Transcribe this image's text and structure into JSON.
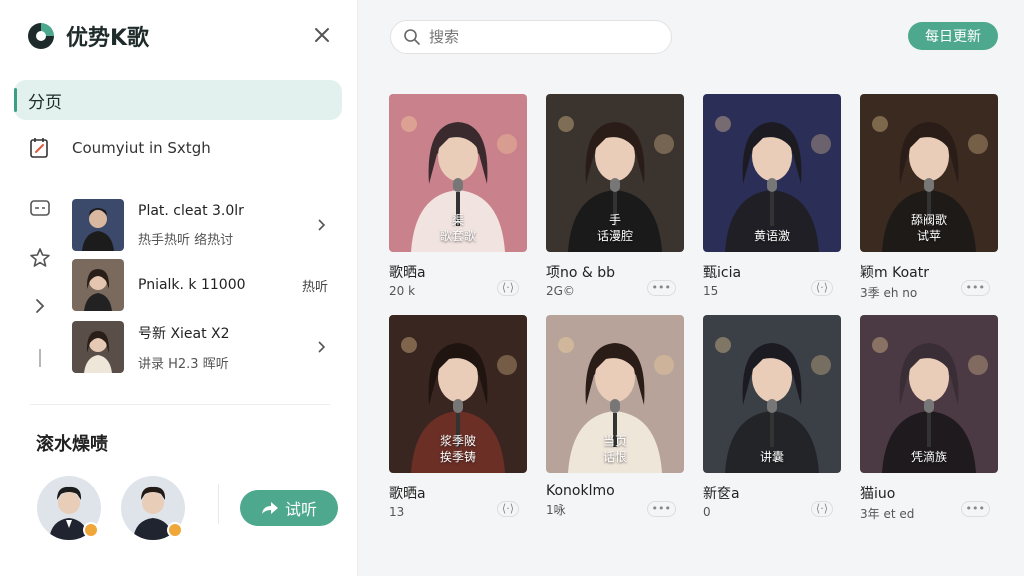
{
  "app": {
    "name": "优势K歌",
    "accent": "#4da88e"
  },
  "nav": {
    "active_label": "分页",
    "item_label": "Coumyiut in Sxtgh"
  },
  "recommendations": [
    {
      "title": "Plat. cleat 3.0lr",
      "subtitle": "热手热听 络热讨",
      "action": "chevron-right-icon"
    },
    {
      "title": "Pnialk. k 11000",
      "tag": "热听"
    },
    {
      "title": "号新 Xieat X2",
      "subtitle": "讲录 H2.3 晖听",
      "action": "chevron-right-icon"
    }
  ],
  "section": {
    "title": "滚水燥啧"
  },
  "listen_button": {
    "label": "试听"
  },
  "search": {
    "placeholder": "搜索"
  },
  "daily_button": {
    "label": "每日更新"
  },
  "cards": [
    {
      "caption": [
        "渠",
        "歌套歌"
      ],
      "title": "歌晒a",
      "meta": "20 k",
      "more": "⟨·⟩"
    },
    {
      "caption": [
        "手",
        "话漫腔"
      ],
      "title": "项no & bb",
      "meta": "2G©",
      "more": "•••"
    },
    {
      "caption": [
        "黄语激"
      ],
      "title": "甄icia",
      "meta": "15",
      "more": "⟨·⟩"
    },
    {
      "caption": [
        "舔阀歌",
        "试苹"
      ],
      "title": "颖m Koatr",
      "meta": "3季 eh no",
      "more": "•••"
    },
    {
      "caption": [
        "浆季陂",
        "挨季铸"
      ],
      "title": "歌晒a",
      "meta": "13",
      "more": "⟨·⟩"
    },
    {
      "caption": [
        "当页",
        "话恨"
      ],
      "title": "Konoklmo",
      "meta": "1咏",
      "more": "•••"
    },
    {
      "caption": [
        "讲囊"
      ],
      "title": "新奁a",
      "meta": "0",
      "more": "⟨·⟩"
    },
    {
      "caption": [
        "凭滴族"
      ],
      "title": "猫iuo",
      "meta": "3年 et ed",
      "more": "•••"
    }
  ]
}
